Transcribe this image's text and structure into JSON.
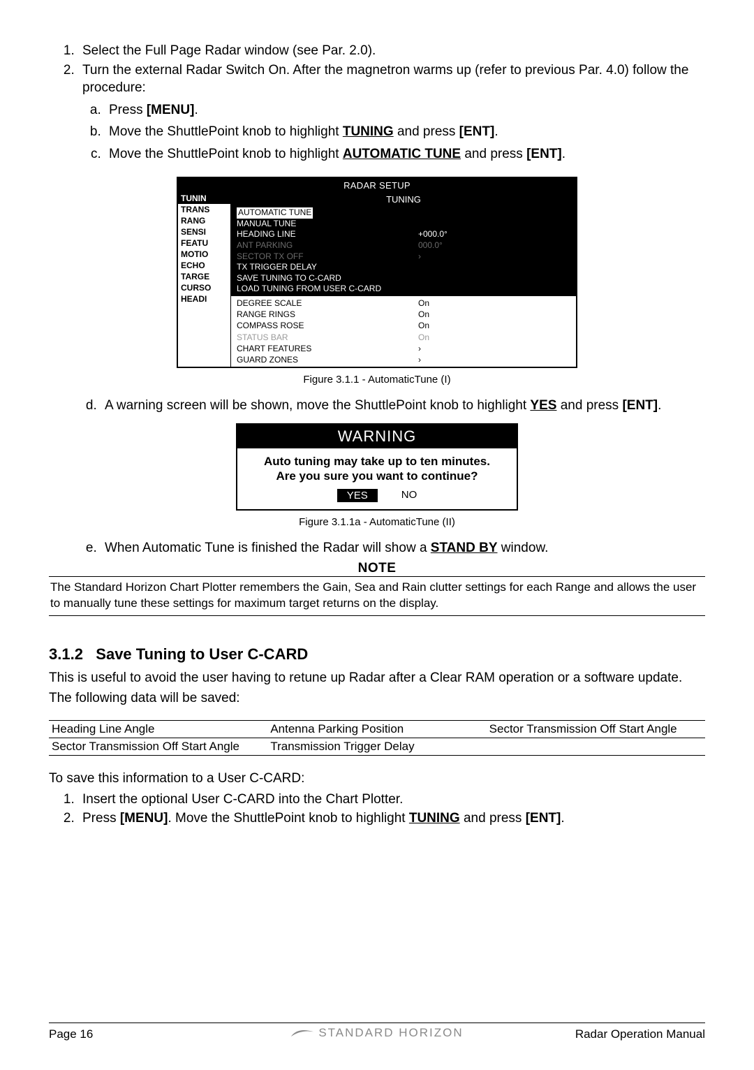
{
  "steps": {
    "s1": "Select the Full Page Radar window (see Par. 2.0).",
    "s2": "Turn the external Radar Switch On. After the magnetron warms up (refer to previous Par. 4.0) follow the procedure:",
    "a_pre": "Press ",
    "a_menu": "[MENU]",
    "a_post": ".",
    "b": "Move the ShuttlePoint knob to highlight ",
    "b_u": "TUNING",
    "b_mid": " and press ",
    "b_ent": "[ENT]",
    "b_post": ".",
    "c": "Move the ShuttlePoint knob to highlight ",
    "c_u": "AUTOMATIC TUNE",
    "c_mid": " and press ",
    "c_ent": "[ENT]",
    "c_post": ".",
    "d": "A warning screen will be shown, move the ShuttlePoint knob to highlight ",
    "d_u": "YES",
    "d_mid": " and press ",
    "d_ent": "[ENT]",
    "d_post": ".",
    "e": "When Automatic Tune is finished the Radar will show a ",
    "e_u": "STAND BY",
    "e_post": " window."
  },
  "radar": {
    "title": "RADAR SETUP",
    "subtitle": "TUNING",
    "side": [
      "TUNIN",
      "TRANS",
      "RANG",
      "SENSI",
      "FEATU",
      "MOTIO",
      "ECHO",
      "TARGE",
      "CURSO",
      "HEADI"
    ],
    "menu": [
      {
        "label": "AUTOMATIC TUNE",
        "val": "",
        "hl": true
      },
      {
        "label": "MANUAL TUNE",
        "val": ""
      },
      {
        "label": "HEADING LINE",
        "val": "+000.0°"
      },
      {
        "label": "ANT PARKING",
        "val": "000.0°",
        "dim": true
      },
      {
        "label": "SECTOR TX OFF",
        "val": "›",
        "dim": true
      },
      {
        "label": "TX TRIGGER DELAY",
        "val": ""
      },
      {
        "label": "SAVE TUNING TO C-CARD",
        "val": ""
      },
      {
        "label": "LOAD TUNING FROM USER C-CARD",
        "val": ""
      }
    ],
    "list": [
      {
        "label": "DEGREE SCALE",
        "val": "On"
      },
      {
        "label": "RANGE RINGS",
        "val": "On"
      },
      {
        "label": "COMPASS ROSE",
        "val": "On"
      },
      {
        "label": "STATUS BAR",
        "val": "On",
        "dim": true
      },
      {
        "label": "CHART FEATURES",
        "val": "›"
      },
      {
        "label": "GUARD ZONES",
        "val": "›"
      }
    ]
  },
  "figcap1": "Figure 3.1.1 - AutomaticTune (I)",
  "warning": {
    "title": "WARNING",
    "l1": "Auto tuning may take up to ten minutes.",
    "l2": "Are you sure you want to continue?",
    "yes": "YES",
    "no": "NO"
  },
  "figcap2": "Figure 3.1.1a - AutomaticTune (II)",
  "note_label": "NOTE",
  "note_text": "The Standard Horizon Chart Plotter remembers the Gain, Sea and Rain clutter settings for each Range and allows the user to manually tune these settings for maximum target returns on the display.",
  "section": {
    "num": "3.1.2",
    "title": "Save Tuning to User C-CARD",
    "p1": "This is useful to avoid the user having to retune up Radar after a Clear RAM operation or a software update.",
    "p2": "The following data will be saved:"
  },
  "saved_table": [
    [
      "Heading Line Angle",
      "Antenna Parking Position",
      "Sector Transmission Off Start Angle"
    ],
    [
      "Sector Transmission Off Start Angle",
      "Transmission Trigger Delay",
      ""
    ]
  ],
  "save_steps": {
    "intro": "To save this information to a User C-CARD:",
    "s1": "Insert the optional User C-CARD into the Chart Plotter.",
    "s2a": "Press ",
    "s2_menu": "[MENU]",
    "s2b": ". Move the ShuttlePoint knob to highlight ",
    "s2_u": "TUNING",
    "s2c": " and press ",
    "s2_ent": "[ENT]",
    "s2d": "."
  },
  "footer": {
    "left": "Page  16",
    "brand": "STANDARD HORIZON",
    "right": "Radar Operation Manual"
  }
}
